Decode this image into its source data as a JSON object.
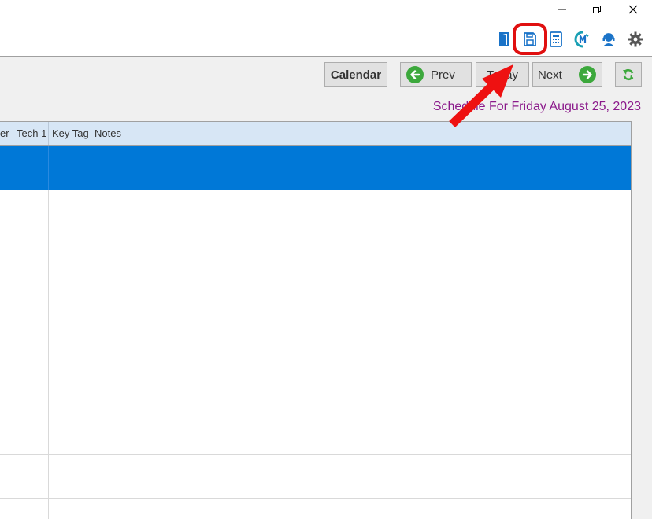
{
  "window": {
    "controls": [
      "minimize-icon",
      "restore-icon",
      "close-icon"
    ]
  },
  "toolbar": {
    "icons": [
      "exit-door-icon",
      "save-icon",
      "calculator-icon",
      "m-logo-icon",
      "support-agent-icon",
      "gear-icon"
    ],
    "highlighted": "save-icon",
    "colors": {
      "icon_blue": "#1a73c8",
      "highlight": "#e01010"
    }
  },
  "nav": {
    "calendar_label": "Calendar",
    "prev_label": "Prev",
    "today_label": "Today",
    "next_label": "Next",
    "refresh_icon": "refresh-icon"
  },
  "schedule": {
    "title": "Schedule For Friday August 25, 2023",
    "title_color": "#8b1a8b"
  },
  "grid": {
    "columns": [
      "er",
      "Tech 1",
      "Key Tag",
      "Notes"
    ],
    "rows": [
      {
        "selected": true
      },
      {
        "selected": false
      },
      {
        "selected": false
      },
      {
        "selected": false
      },
      {
        "selected": false
      },
      {
        "selected": false
      },
      {
        "selected": false
      },
      {
        "selected": false
      }
    ],
    "header_color": "#d7e6f5",
    "selection_color": "#0078d7"
  }
}
